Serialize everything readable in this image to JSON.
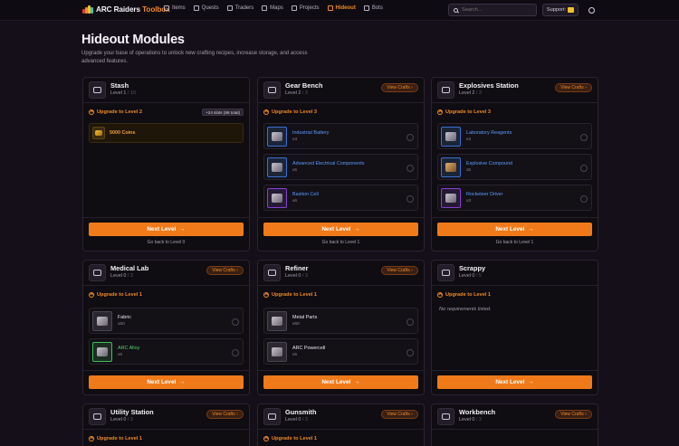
{
  "app": {
    "logo_prefix": "ARC Raiders",
    "logo_suffix": "Toolbox",
    "nav": [
      {
        "label": "Items",
        "active": false
      },
      {
        "label": "Quests",
        "active": false
      },
      {
        "label": "Traders",
        "active": false
      },
      {
        "label": "Maps",
        "active": false
      },
      {
        "label": "Projects",
        "active": false
      },
      {
        "label": "Hideout",
        "active": true
      },
      {
        "label": "Bots",
        "active": false
      }
    ],
    "search_placeholder": "Search...",
    "support_label": "Support:"
  },
  "page": {
    "title": "Hideout Modules",
    "subtitle": "Upgrade your base of operations to unlock new crafting recipes, increase storage, and access advanced features."
  },
  "colors": {
    "accent": "#f07a1a",
    "background": "#140f19",
    "uncommon_green": "#4fd36a",
    "rare_blue": "#5d9bff",
    "epic_purple": "#8a3fd6"
  },
  "modules": [
    {
      "title": "Stash",
      "level": "Level 1",
      "max": "/ 10",
      "view_crafts": "",
      "upgrade_label": "Upgrade to Level 2",
      "badge": "+24 slots (88 total)",
      "requirements": [
        {
          "name": "5000 Coins",
          "qty": "",
          "rarity": "coins"
        }
      ],
      "next_label": "Next Level",
      "back_label": "Go back to Level 0"
    },
    {
      "title": "Gear Bench",
      "level": "Level 2",
      "max": "/ 3",
      "view_crafts": "View Crafts",
      "upgrade_label": "Upgrade to Level 3",
      "badge": "",
      "requirements": [
        {
          "name": "Industrial Battery",
          "qty": "x3",
          "rarity": "blue"
        },
        {
          "name": "Advanced Electrical Components",
          "qty": "x5",
          "rarity": "blue"
        },
        {
          "name": "Bastion Cell",
          "qty": "x6",
          "rarity": "purple"
        }
      ],
      "next_label": "Next Level",
      "back_label": "Go back to Level 1"
    },
    {
      "title": "Explosives Station",
      "level": "Level 2",
      "max": "/ 3",
      "view_crafts": "View Crafts",
      "upgrade_label": "Upgrade to Level 3",
      "badge": "",
      "requirements": [
        {
          "name": "Laboratory Reagents",
          "qty": "x3",
          "rarity": "blue"
        },
        {
          "name": "Explosive Compound",
          "qty": "x5",
          "rarity": "blue"
        },
        {
          "name": "Rocketeer Driver",
          "qty": "x3",
          "rarity": "purple"
        }
      ],
      "next_label": "Next Level",
      "back_label": "Go back to Level 1"
    },
    {
      "title": "Medical Lab",
      "level": "Level 0",
      "max": "/ 3",
      "view_crafts": "View Crafts",
      "upgrade_label": "Upgrade to Level 1",
      "badge": "",
      "requirements": [
        {
          "name": "Fabric",
          "qty": "x50",
          "rarity": "common"
        },
        {
          "name": "ARC Alloy",
          "qty": "x6",
          "rarity": "green"
        }
      ],
      "next_label": "Next Level",
      "back_label": ""
    },
    {
      "title": "Refiner",
      "level": "Level 0",
      "max": "/ 3",
      "view_crafts": "View Crafts",
      "upgrade_label": "Upgrade to Level 1",
      "badge": "",
      "requirements": [
        {
          "name": "Metal Parts",
          "qty": "x60",
          "rarity": "common"
        },
        {
          "name": "ARC Powercell",
          "qty": "x5",
          "rarity": "common"
        }
      ],
      "next_label": "Next Level",
      "back_label": ""
    },
    {
      "title": "Scrappy",
      "level": "Level 0",
      "max": "/ 5",
      "view_crafts": "",
      "upgrade_label": "Upgrade to Level 1",
      "badge": "",
      "requirements": [],
      "no_requirements": "No requirements listed.",
      "next_label": "Next Level",
      "back_label": ""
    },
    {
      "title": "Utility Station",
      "level": "Level 0",
      "max": "/ 3",
      "view_crafts": "View Crafts",
      "upgrade_label": "Upgrade to Level 1",
      "badge": "",
      "requirements": [],
      "next_label": "",
      "back_label": ""
    },
    {
      "title": "Gunsmith",
      "level": "Level 0",
      "max": "/ 3",
      "view_crafts": "View Crafts",
      "upgrade_label": "Upgrade to Level 1",
      "badge": "",
      "requirements": [],
      "next_label": "",
      "back_label": ""
    },
    {
      "title": "Workbench",
      "level": "Level 0",
      "max": "/ 3",
      "view_crafts": "View Crafts",
      "upgrade_label": "",
      "badge": "",
      "requirements": [],
      "next_label": "",
      "back_label": ""
    }
  ]
}
